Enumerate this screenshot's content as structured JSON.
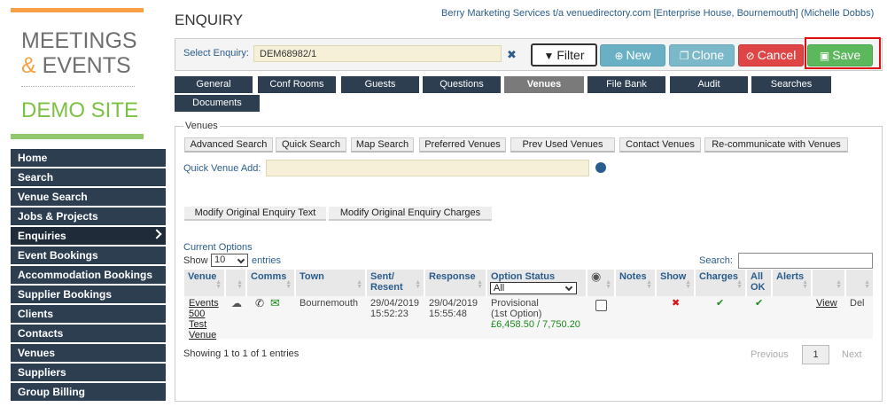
{
  "logo": {
    "line1": "MEETINGS",
    "amp": "&",
    "line2": "EVENTS",
    "demo": "DEMO SITE"
  },
  "nav": [
    {
      "label": "Home"
    },
    {
      "label": "Search"
    },
    {
      "label": "Venue Search"
    },
    {
      "label": "Jobs & Projects"
    },
    {
      "label": "Enquiries",
      "active": true
    },
    {
      "label": "Event Bookings"
    },
    {
      "label": "Accommodation Bookings"
    },
    {
      "label": "Supplier Bookings"
    },
    {
      "label": "Clients"
    },
    {
      "label": "Contacts"
    },
    {
      "label": "Venues"
    },
    {
      "label": "Suppliers"
    },
    {
      "label": "Group Billing"
    }
  ],
  "header": {
    "title": "ENQUIRY",
    "client": "Berry Marketing Services t/a venuedirectory.com [Enterprise House, Bournemouth] (Michelle Dobbs)"
  },
  "toolbar": {
    "select_label": "Select Enquiry:",
    "enquiry_value": "DEM68982/1",
    "filter": "Filter",
    "new": "New",
    "clone": "Clone",
    "cancel": "Cancel",
    "save": "Save"
  },
  "tabs": [
    "General",
    "Conf Rooms",
    "Guests",
    "Questions",
    "Venues",
    "File Bank",
    "Audit",
    "Searches",
    "Documents"
  ],
  "active_tab": "Venues",
  "venues": {
    "legend": "Venues",
    "buttons": [
      "Advanced Search",
      "Quick Search",
      "Map Search",
      "Preferred Venues",
      "Prev Used Venues",
      "Contact Venues",
      "Re-communicate with Venues"
    ],
    "quick_add_label": "Quick Venue Add:",
    "modify_buttons": [
      "Modify Original Enquiry Text",
      "Modify Original Enquiry Charges"
    ],
    "current_options": "Current Options",
    "show_label": "Show",
    "show_value": "10",
    "entries_label": "entries",
    "search_label": "Search:"
  },
  "table": {
    "headers": [
      "Venue",
      "Comms",
      "Town",
      "Sent/ Resent",
      "Response",
      "Option Status",
      "Notes",
      "Show",
      "Charges",
      "All OK",
      "Alerts"
    ],
    "status_filter": "All",
    "rows": [
      {
        "venue": "Events 500 Test Venue",
        "town": "Bournemouth",
        "sent": "29/04/2019 15:52:23",
        "response": "29/04/2019 15:55:48",
        "status": "Provisional (1st Option)",
        "amount": "£6,458.50 / 7,750.20",
        "view": "View",
        "del": "Del"
      }
    ],
    "showing": "Showing 1 to 1 of 1 entries",
    "prev": "Previous",
    "page": "1",
    "next": "Next"
  }
}
